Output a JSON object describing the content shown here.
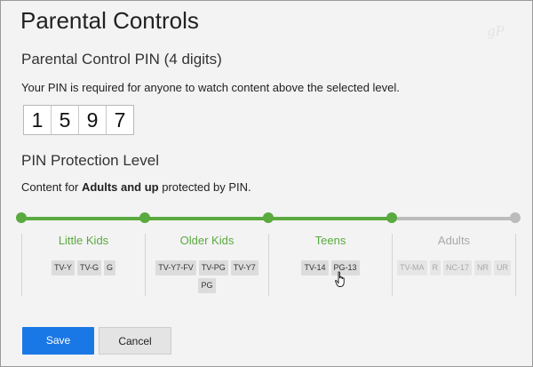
{
  "page": {
    "title": "Parental Controls",
    "watermark": "gP"
  },
  "pin_section": {
    "heading": "Parental Control PIN (4 digits)",
    "description": "Your PIN is required for anyone to watch content above the selected level.",
    "digits": [
      "1",
      "5",
      "9",
      "7"
    ]
  },
  "protection": {
    "heading": "PIN Protection Level",
    "desc_prefix": "Content for ",
    "desc_bold": "Adults and up",
    "desc_suffix": " protected by PIN.",
    "selected_level": "Teens",
    "levels": [
      {
        "name": "Little Kids",
        "ratings": [
          "TV-Y",
          "TV-G",
          "G"
        ],
        "enabled": true
      },
      {
        "name": "Older Kids",
        "ratings": [
          "TV-Y7-FV",
          "TV-PG",
          "TV-Y7",
          "PG"
        ],
        "enabled": true
      },
      {
        "name": "Teens",
        "ratings": [
          "TV-14",
          "PG-13"
        ],
        "enabled": true
      },
      {
        "name": "Adults",
        "ratings": [
          "TV-MA",
          "R",
          "NC-17",
          "NR",
          "UR"
        ],
        "enabled": false
      }
    ]
  },
  "colors": {
    "active": "#5aaa3f",
    "inactive": "#bcbcbc",
    "primary_button": "#1a77e6"
  },
  "buttons": {
    "save": "Save",
    "cancel": "Cancel"
  }
}
